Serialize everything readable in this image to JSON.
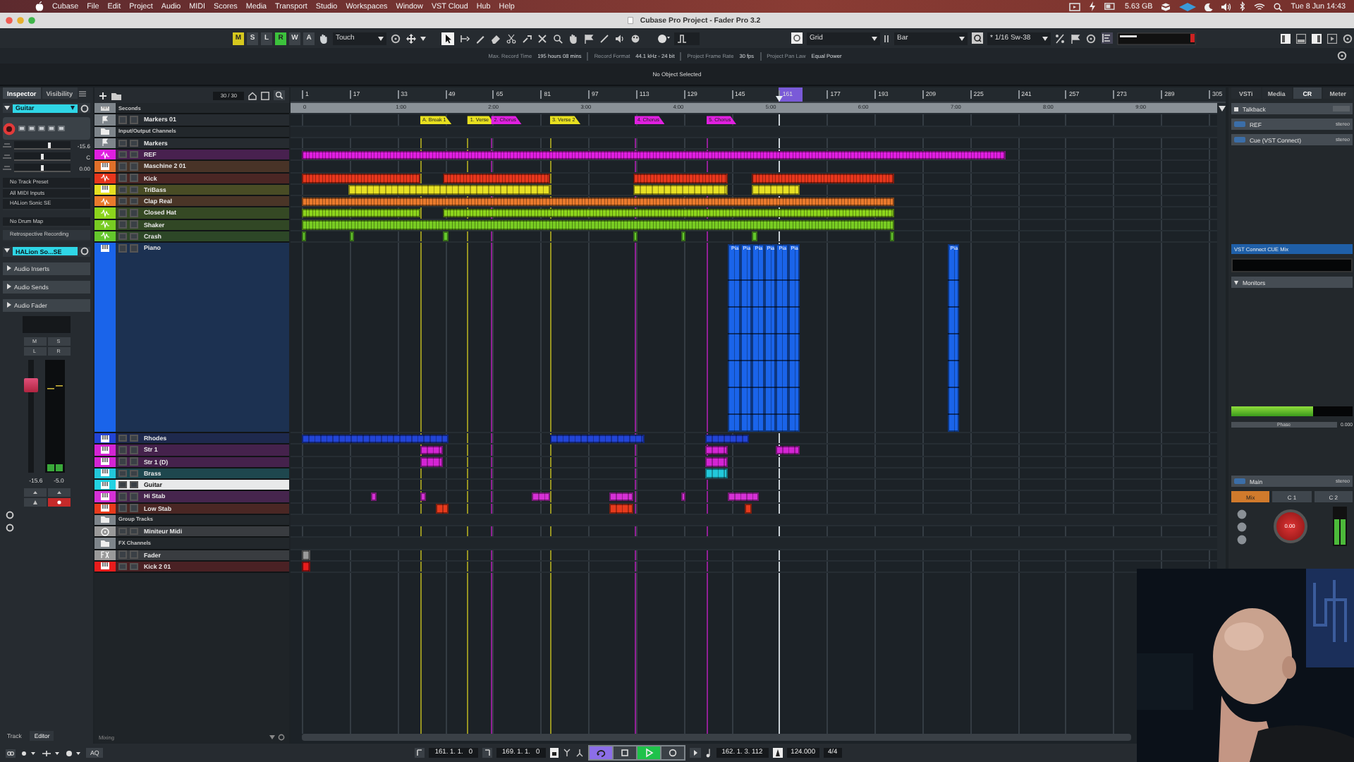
{
  "menubar": {
    "app": "Cubase",
    "menus": [
      "File",
      "Edit",
      "Project",
      "Audio",
      "MIDI",
      "Scores",
      "Media",
      "Transport",
      "Studio",
      "Workspaces",
      "Window",
      "VST Cloud",
      "Hub",
      "Help"
    ],
    "storage": "5.63 GB",
    "clock": "Tue 8 Jun  14:43"
  },
  "window": {
    "title": "Cubase Pro Project - Fader Pro 3.2"
  },
  "toolbar": {
    "automation": [
      {
        "label": "M",
        "on": true,
        "color": "#d6c81e"
      },
      {
        "label": "S",
        "on": false
      },
      {
        "label": "L",
        "on": false
      },
      {
        "label": "R",
        "on": true,
        "color": "#3cc23c"
      },
      {
        "label": "W",
        "on": false
      },
      {
        "label": "A",
        "on": false
      }
    ],
    "automation_mode": "Touch",
    "snap_type": "Grid",
    "grid": "Bar",
    "quantize": "* 1/16  Sw-38"
  },
  "info_line": [
    {
      "label": "Max. Record Time",
      "value": "195 hours 08 mins"
    },
    {
      "label": "Record Format",
      "value": "44.1 kHz - 24 bit"
    },
    {
      "label": "Project Frame Rate",
      "value": "30 fps"
    },
    {
      "label": "Project Pan Law",
      "value": "Equal Power"
    }
  ],
  "selection_info": "No Object Selected",
  "inspector": {
    "tabs": [
      {
        "label": "Inspector",
        "selected": true
      },
      {
        "label": "Visibility",
        "selected": false
      }
    ],
    "track_name": "Guitar",
    "record_enabled": true,
    "params": [
      {
        "value": "-15.6",
        "level": 0.62
      },
      {
        "value": "C",
        "level": 0.5
      },
      {
        "value": "0.00",
        "level": 0.5
      }
    ],
    "routing": [
      "No Track Preset",
      "All MIDI Inputs",
      "HALion Sonic SE"
    ],
    "drum_map": "No Drum Map",
    "retrospective": "Retrospective Recording",
    "instrument": "HALion So...SE",
    "sections": [
      "Audio Inserts",
      "Audio Sends",
      "Audio Fader"
    ],
    "fader": {
      "level": 0.77,
      "buttons": [
        "M",
        "S",
        "L",
        "R"
      ],
      "readouts": [
        "-15.6",
        "-5.0"
      ]
    },
    "bottom_tabs": [
      {
        "label": "Track",
        "selected": false
      },
      {
        "label": "Editor",
        "selected": true
      }
    ]
  },
  "track_list": {
    "count": "30 / 30",
    "footer": "Mixing"
  },
  "tracks": [
    {
      "name": "Seconds",
      "kind": "ruler",
      "selected": false
    },
    {
      "name": "Markers 01",
      "kind": "marker",
      "selected": false,
      "markers": [
        {
          "label": "A. Break 1",
          "color": "#e8e020"
        },
        {
          "label": "1. Verse",
          "color": "#e8e020"
        },
        {
          "label": "2. Chorus",
          "color": "#e020e0"
        },
        {
          "label": "3. Verse 2",
          "color": "#e8e020"
        },
        {
          "label": "4. Chorus",
          "color": "#e020e0"
        },
        {
          "label": "5. Chorus",
          "color": "#e020e0"
        }
      ]
    },
    {
      "name": "Input/Output Channels",
      "kind": "folder",
      "selected": false
    },
    {
      "name": "Markers",
      "kind": "marker",
      "selected": false
    },
    {
      "name": "REF",
      "kind": "audio",
      "color": "#e01ee0",
      "selected": false
    },
    {
      "name": "Maschine 2 01",
      "kind": "instrument",
      "color": "#e0702a",
      "selected": false
    },
    {
      "name": "Kick",
      "kind": "audio",
      "color": "#e8361c",
      "selected": false
    },
    {
      "name": "TriBass",
      "kind": "instrument",
      "color": "#e6e022",
      "selected": false
    },
    {
      "name": "Clap Real",
      "kind": "audio",
      "color": "#ea7a2c",
      "selected": false
    },
    {
      "name": "Closed Hat",
      "kind": "audio",
      "color": "#8cd41c",
      "selected": false
    },
    {
      "name": "Shaker",
      "kind": "audio",
      "color": "#78cc22",
      "selected": false
    },
    {
      "name": "Crash",
      "kind": "audio",
      "color": "#64c82c",
      "selected": false
    },
    {
      "name": "Piano",
      "kind": "instrument",
      "color": "#1a64ea",
      "selected": false,
      "expanded": true,
      "part_labels": [
        "Pia",
        "Pia",
        "Pia",
        "Pia",
        "Pia",
        "Pia",
        "Pia"
      ]
    },
    {
      "name": "Rhodes",
      "kind": "instrument",
      "color": "#2244d6",
      "selected": false
    },
    {
      "name": "Str 1",
      "kind": "instrument",
      "color": "#d424d4",
      "selected": false
    },
    {
      "name": "Str 1 (D)",
      "kind": "instrument",
      "color": "#d424d4",
      "selected": false
    },
    {
      "name": "Brass",
      "kind": "instrument",
      "color": "#22c8da",
      "selected": false
    },
    {
      "name": "Guitar",
      "kind": "instrument",
      "color": "#22d2e2",
      "selected": true
    },
    {
      "name": "Hi Stab",
      "kind": "instrument",
      "color": "#d630d6",
      "selected": false
    },
    {
      "name": "Low Stab",
      "kind": "instrument",
      "color": "#e83a1c",
      "selected": false
    },
    {
      "name": "Group Tracks",
      "kind": "folder",
      "selected": false
    },
    {
      "name": "Miniteur Midi",
      "kind": "midi",
      "color": "#9a9a9a",
      "selected": false
    },
    {
      "name": "FX Channels",
      "kind": "folder",
      "selected": false
    },
    {
      "name": "Fader",
      "kind": "fx",
      "color": "#9a9a9a",
      "selected": false
    },
    {
      "name": "Kick 2 01",
      "kind": "instrument",
      "color": "#e81c1c",
      "selected": false
    }
  ],
  "arrange": {
    "bars": [
      "1",
      "17",
      "33",
      "49",
      "65",
      "81",
      "97",
      "113",
      "129",
      "145",
      "161",
      "177",
      "193",
      "209",
      "225",
      "241",
      "257",
      "273",
      "289",
      "305"
    ],
    "times": [
      "0",
      "1:00",
      "2:00",
      "3:00",
      "4:00",
      "5:00",
      "6:00",
      "7:00",
      "8:00",
      "9:00"
    ]
  },
  "control_room": {
    "tabs": [
      {
        "label": "VSTi",
        "selected": false
      },
      {
        "label": "Media",
        "selected": false
      },
      {
        "label": "CR",
        "selected": true
      },
      {
        "label": "Meter",
        "selected": false
      }
    ],
    "talkback": "Talkback",
    "cues": [
      {
        "name": "REF",
        "format": "stereo"
      },
      {
        "name": "Cue (VST Connect)",
        "format": "stereo"
      }
    ],
    "cue_mix": "VST Connect CUE Mix",
    "monitors": "Monitors",
    "meter": {
      "level": 0.68
    },
    "phase_label": "Phase",
    "phase_value": "0.000",
    "main": {
      "name": "Main",
      "format": "stereo"
    },
    "sources": [
      {
        "label": "Mix",
        "selected": true
      },
      {
        "label": "C 1",
        "selected": false
      },
      {
        "label": "C 2",
        "selected": false
      }
    ],
    "knob": "0.00"
  },
  "transport": {
    "aq": "AQ",
    "left_locator": "161. 1. 1.   0",
    "right_locator": "169. 1. 1.   0",
    "buttons": [
      {
        "kind": "cycle",
        "on": true
      },
      {
        "kind": "stop",
        "on": false
      },
      {
        "kind": "play",
        "on": true
      },
      {
        "kind": "record",
        "on": false
      }
    ],
    "position": "162. 1. 3. 112",
    "tempo": "124.000",
    "signature": "4/4"
  }
}
